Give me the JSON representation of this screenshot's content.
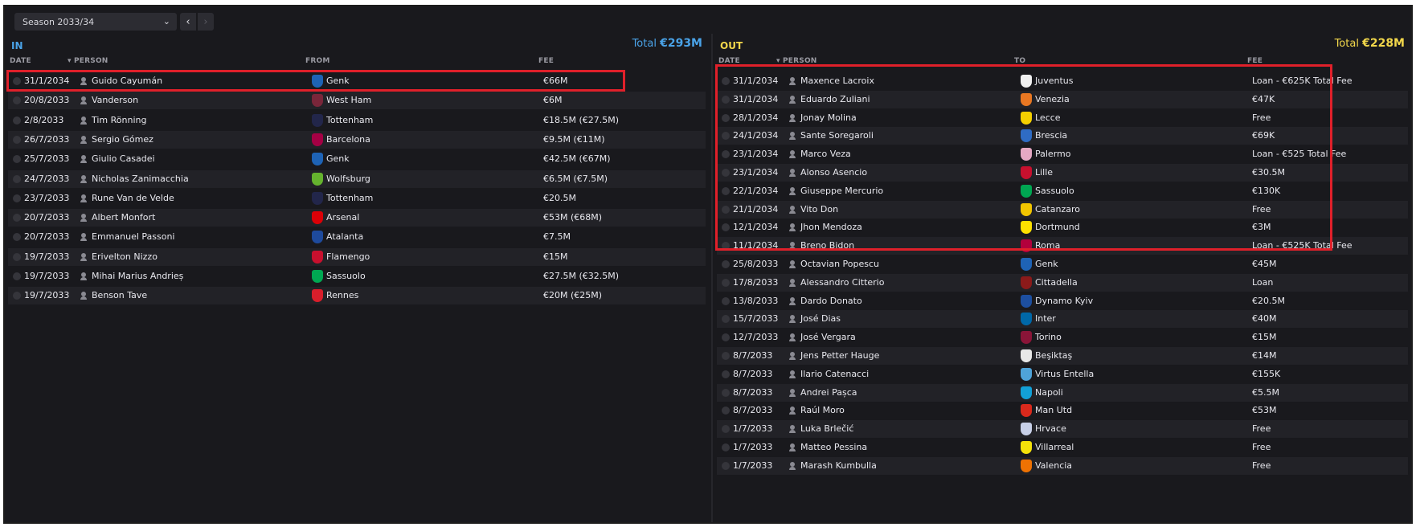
{
  "season": {
    "label": "Season 2033/34"
  },
  "in": {
    "title": "IN",
    "total_label": "Total",
    "total_value": "€293M",
    "columns": {
      "date": "DATE",
      "person": "PERSON",
      "club": "FROM",
      "fee": "FEE"
    },
    "rows": [
      {
        "date": "31/1/2034",
        "person": "Guido Cayumán",
        "club": "Genk",
        "club_color": "#1e63b5",
        "fee": "€66M"
      },
      {
        "date": "20/8/2033",
        "person": "Vanderson",
        "club": "West Ham",
        "club_color": "#7a263a",
        "fee": "€6M"
      },
      {
        "date": "2/8/2033",
        "person": "Tim Rönning",
        "club": "Tottenham",
        "club_color": "#22264a",
        "fee": "€18.5M (€27.5M)"
      },
      {
        "date": "26/7/2033",
        "person": "Sergio Gómez",
        "club": "Barcelona",
        "club_color": "#a50044",
        "fee": "€9.5M (€11M)"
      },
      {
        "date": "25/7/2033",
        "person": "Giulio Casadei",
        "club": "Genk",
        "club_color": "#1e63b5",
        "fee": "€42.5M (€67M)"
      },
      {
        "date": "24/7/2033",
        "person": "Nicholas Zanimacchia",
        "club": "Wolfsburg",
        "club_color": "#65b32e",
        "fee": "€6.5M (€7.5M)"
      },
      {
        "date": "23/7/2033",
        "person": "Rune Van de Velde",
        "club": "Tottenham",
        "club_color": "#22264a",
        "fee": "€20.5M"
      },
      {
        "date": "20/7/2033",
        "person": "Albert Monfort",
        "club": "Arsenal",
        "club_color": "#db0007",
        "fee": "€53M (€68M)"
      },
      {
        "date": "20/7/2033",
        "person": "Emmanuel Passoni",
        "club": "Atalanta",
        "club_color": "#1e4a9c",
        "fee": "€7.5M"
      },
      {
        "date": "19/7/2033",
        "person": "Erivelton Nizzo",
        "club": "Flamengo",
        "club_color": "#c8102e",
        "fee": "€15M"
      },
      {
        "date": "19/7/2033",
        "person": "Mihai Marius Andrieș",
        "club": "Sassuolo",
        "club_color": "#00a752",
        "fee": "€27.5M (€32.5M)"
      },
      {
        "date": "19/7/2033",
        "person": "Benson Tave",
        "club": "Rennes",
        "club_color": "#d81e2b",
        "fee": "€20M (€25M)"
      }
    ]
  },
  "out": {
    "title": "OUT",
    "total_label": "Total",
    "total_value": "€228M",
    "columns": {
      "date": "DATE",
      "person": "PERSON",
      "club": "TO",
      "fee": "FEE"
    },
    "rows": [
      {
        "date": "31/1/2034",
        "person": "Maxence Lacroix",
        "club": "Juventus",
        "club_color": "#f0f0f0",
        "fee": "Loan - €625K Total Fee"
      },
      {
        "date": "31/1/2034",
        "person": "Eduardo Zuliani",
        "club": "Venezia",
        "club_color": "#e87722",
        "fee": "€47K"
      },
      {
        "date": "28/1/2034",
        "person": "Jonay Molina",
        "club": "Lecce",
        "club_color": "#f5d000",
        "fee": "Free"
      },
      {
        "date": "24/1/2034",
        "person": "Sante Soregaroli",
        "club": "Brescia",
        "club_color": "#2f6cc4",
        "fee": "€69K"
      },
      {
        "date": "23/1/2034",
        "person": "Marco Veza",
        "club": "Palermo",
        "club_color": "#e6a9c4",
        "fee": "Loan - €525 Total Fee"
      },
      {
        "date": "23/1/2034",
        "person": "Alonso Asencio",
        "club": "Lille",
        "club_color": "#c8102e",
        "fee": "€30.5M"
      },
      {
        "date": "22/1/2034",
        "person": "Giuseppe Mercurio",
        "club": "Sassuolo",
        "club_color": "#00a752",
        "fee": "€130K"
      },
      {
        "date": "21/1/2034",
        "person": "Vito Don",
        "club": "Catanzaro",
        "club_color": "#f2c500",
        "fee": "Free"
      },
      {
        "date": "12/1/2034",
        "person": "Jhon Mendoza",
        "club": "Dortmund",
        "club_color": "#fde100",
        "fee": "€3M"
      },
      {
        "date": "11/1/2034",
        "person": "Breno Bidon",
        "club": "Roma",
        "club_color": "#b3003c",
        "fee": "Loan - €525K Total Fee"
      },
      {
        "date": "25/8/2033",
        "person": "Octavian Popescu",
        "club": "Genk",
        "club_color": "#1e63b5",
        "fee": "€45M"
      },
      {
        "date": "17/8/2033",
        "person": "Alessandro Citterio",
        "club": "Cittadella",
        "club_color": "#8b1a1a",
        "fee": "Loan"
      },
      {
        "date": "13/8/2033",
        "person": "Dardo Donato",
        "club": "Dynamo Kyiv",
        "club_color": "#1d4fa0",
        "fee": "€20.5M"
      },
      {
        "date": "15/7/2033",
        "person": "José Dias",
        "club": "Inter",
        "club_color": "#0068a8",
        "fee": "€40M"
      },
      {
        "date": "12/7/2033",
        "person": "José Vergara",
        "club": "Torino",
        "club_color": "#8a1538",
        "fee": "€15M"
      },
      {
        "date": "8/7/2033",
        "person": "Jens Petter Hauge",
        "club": "Beşiktaş",
        "club_color": "#e8e8e8",
        "fee": "€14M"
      },
      {
        "date": "8/7/2033",
        "person": "Ilario Catenacci",
        "club": "Virtus Entella",
        "club_color": "#4fa3d9",
        "fee": "€155K"
      },
      {
        "date": "8/7/2033",
        "person": "Andrei Pașca",
        "club": "Napoli",
        "club_color": "#12a0d7",
        "fee": "€5.5M"
      },
      {
        "date": "8/7/2033",
        "person": "Raúl Moro",
        "club": "Man Utd",
        "club_color": "#da291c",
        "fee": "€53M"
      },
      {
        "date": "1/7/2033",
        "person": "Luka Brlečić",
        "club": "Hrvace",
        "club_color": "#c8d0e8",
        "fee": "Free"
      },
      {
        "date": "1/7/2033",
        "person": "Matteo Pessina",
        "club": "Villarreal",
        "club_color": "#f5e20a",
        "fee": "Free"
      },
      {
        "date": "1/7/2033",
        "person": "Marash Kumbulla",
        "club": "Valencia",
        "club_color": "#ee7203",
        "fee": "Free"
      }
    ]
  }
}
